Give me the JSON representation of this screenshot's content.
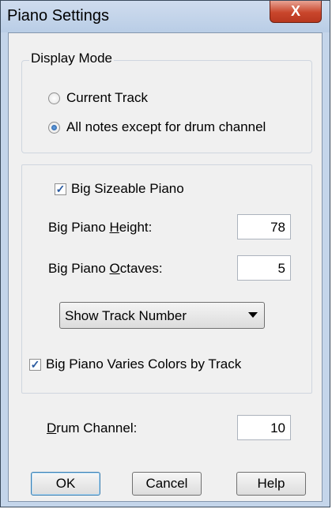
{
  "window": {
    "title": "Piano Settings",
    "close_glyph": "X"
  },
  "display_mode": {
    "label": "Display Mode",
    "options": [
      {
        "label": "Current Track",
        "selected": false
      },
      {
        "label": "All notes except for drum channel",
        "selected": true
      }
    ]
  },
  "piano": {
    "big_sizeable": {
      "label": "Big Sizeable Piano",
      "checked": true
    },
    "height": {
      "label_pre": "Big Piano ",
      "label_key": "H",
      "label_post": "eight:",
      "value": "78"
    },
    "octaves": {
      "label_pre": "Big Piano ",
      "label_key": "O",
      "label_post": "ctaves:",
      "value": "5"
    },
    "dropdown": {
      "selected": "Show Track Number"
    },
    "varies_colors": {
      "label": "Big Piano Varies Colors by Track",
      "checked": true
    }
  },
  "drum_channel": {
    "label_key": "D",
    "label_post": "rum Channel:",
    "value": "10"
  },
  "buttons": {
    "ok": "OK",
    "cancel": "Cancel",
    "help": "Help"
  },
  "icons": {
    "close": "close-icon",
    "check": "check-icon",
    "dropdown": "chevron-down-icon"
  }
}
